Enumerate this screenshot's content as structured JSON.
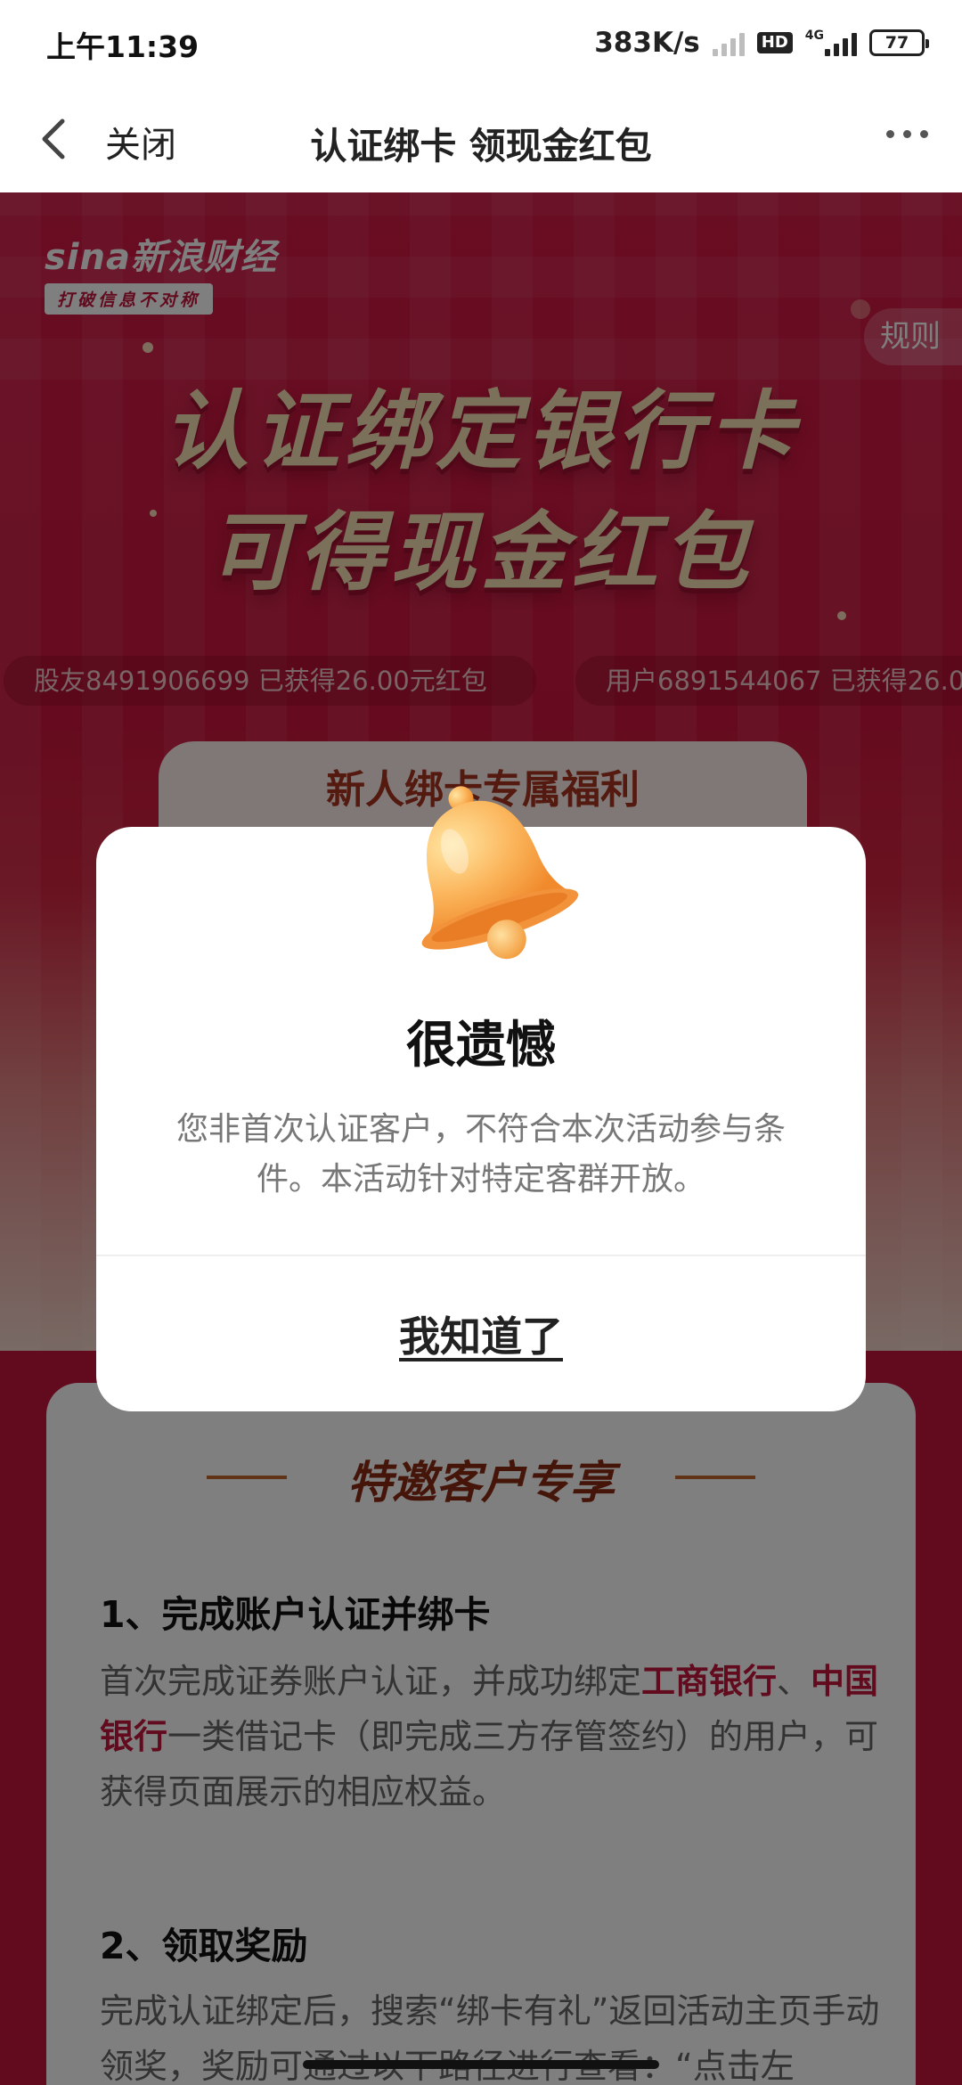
{
  "status_bar": {
    "time": "上午11:39",
    "net_speed": "383K/s",
    "hd": "HD",
    "network": "4G",
    "battery": "77"
  },
  "nav": {
    "close_label": "关闭",
    "title": "认证绑卡 领现金红包"
  },
  "hero": {
    "logo_main": "sina新浪财经",
    "logo_sub": "打破信息不对称",
    "rules_label": "规则",
    "title_line1": "认证绑定银行卡",
    "title_line2": "可得现金红包",
    "tickers": [
      "股友8491906699 已获得26.00元红包",
      "用户6891544067 已获得26.0"
    ]
  },
  "benefit": {
    "title": "新人绑卡专属福利"
  },
  "exclusive": {
    "title": "特邀客户专享",
    "step1_heading": "1、完成账户认证并绑卡",
    "step1_text_a": "首次完成证券账户认证，并成功绑定",
    "step1_bank1": "工商银行",
    "step1_sep": "、",
    "step1_bank2": "中国银行",
    "step1_text_b": "一类借记卡（即完成三方存管签约）的用户，可获得页面展示的相应权益。",
    "step2_heading": "2、领取奖励",
    "step2_text": "完成认证绑定后，搜索“绑卡有礼”返回活动主页手动领奖，奖励可通过以下路径进行查看：“点击左"
  },
  "dialog": {
    "title": "很遗憾",
    "message": "您非首次认证客户，不符合本次活动参与条件。本活动针对特定客群开放。",
    "button_label": "我知道了"
  },
  "colors": {
    "brand_red": "#c7163c",
    "gold_title": "#f6e3b6",
    "bell_orange": "#fbb45a"
  }
}
